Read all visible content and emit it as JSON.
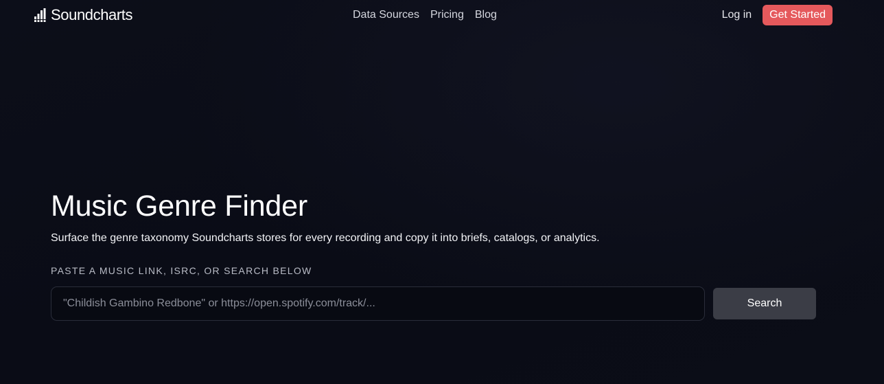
{
  "header": {
    "brand": "Soundcharts",
    "nav_links": [
      "Data Sources",
      "Pricing",
      "Blog"
    ],
    "login_label": "Log in",
    "cta_label": "Get Started"
  },
  "hero": {
    "title": "Music Genre Finder",
    "subtitle": "Surface the genre taxonomy Soundcharts stores for every recording and copy it into briefs, catalogs, or analytics.",
    "field_label": "PASTE A MUSIC LINK, ISRC, OR SEARCH BELOW",
    "search_placeholder": "\"Childish Gambino Redbone\" or https://open.spotify.com/track/...",
    "search_button_label": "Search"
  },
  "icons": {
    "logo": "bar-chart-logo-icon"
  },
  "colors": {
    "background": "#0b0d18",
    "accent": "#e5595c",
    "button_secondary": "#3b3d46"
  }
}
